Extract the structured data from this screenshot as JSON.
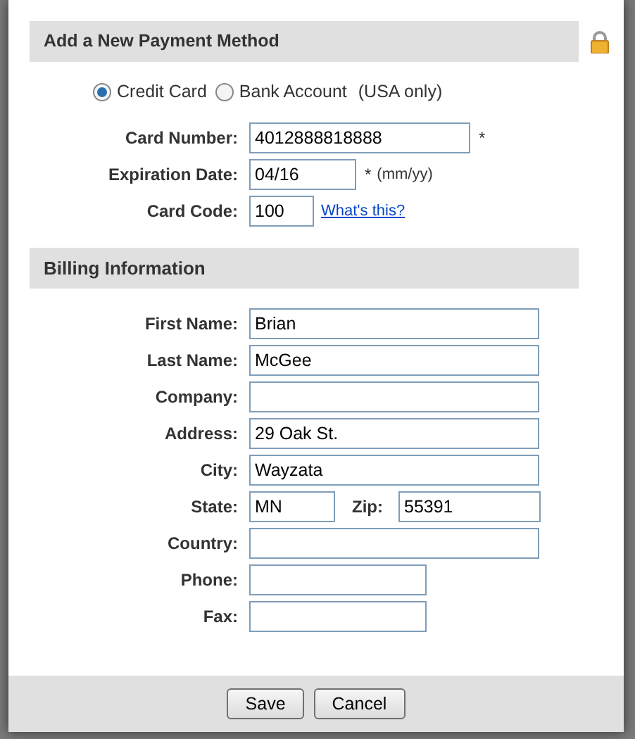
{
  "dialog": {
    "title": "Add a New Payment Method",
    "payment_types": [
      {
        "label": "Credit Card",
        "selected": true
      },
      {
        "label": "Bank Account",
        "selected": false,
        "note": "(USA only)"
      }
    ],
    "card_fields": [
      {
        "label": "Card Number:",
        "value": "4012888818888",
        "kind": "long",
        "required_mark": "*"
      },
      {
        "label": "Expiration Date:",
        "value": "04/16",
        "kind": "medium",
        "required_mark": "*",
        "hint": "(mm/yy)"
      },
      {
        "label": "Card Code:",
        "value": "100",
        "kind": "short",
        "link": "What's this?"
      }
    ],
    "billing_title": "Billing Information",
    "billing_fields": [
      {
        "kind": "long",
        "label": "First Name:",
        "value": "Brian"
      },
      {
        "kind": "long",
        "label": "Last Name:",
        "value": "McGee"
      },
      {
        "kind": "long",
        "label": "Company:"
      },
      {
        "kind": "long",
        "label": "Address:",
        "value": "29 Oak St."
      },
      {
        "kind": "long",
        "label": "City:",
        "value": "Wayzata"
      },
      {
        "kind": "pair",
        "label": "State:",
        "value": "MN",
        "label_2": "Zip:",
        "value_2": "55391"
      },
      {
        "kind": "long",
        "label": "Country:"
      },
      {
        "kind": "medium",
        "label": "Phone:"
      },
      {
        "kind": "medium",
        "label": "Fax:"
      }
    ],
    "buttons": [
      "Save",
      "Cancel"
    ]
  }
}
